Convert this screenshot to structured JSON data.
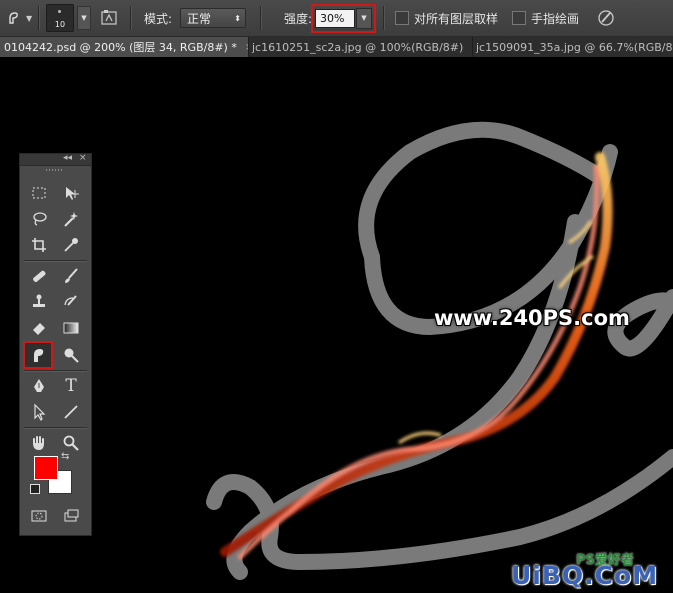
{
  "options_bar": {
    "brush_size": "10",
    "mode_label": "模式:",
    "mode_value": "正常",
    "strength_label": "强度:",
    "strength_value": "30%",
    "sample_all_layers_label": "对所有图层取样",
    "finger_painting_label": "手指绘画",
    "sample_all_layers_checked": false,
    "finger_painting_checked": false
  },
  "tabs": [
    {
      "label": "0104242.psd @ 200% (图层 34, RGB/8#) *",
      "active": true
    },
    {
      "label": "jc1610251_sc2a.jpg @ 100%(RGB/8#)",
      "active": false
    },
    {
      "label": "jc1509091_35a.jpg @ 66.7%(RGB/8#)",
      "active": false
    }
  ],
  "tab_close_glyph": "×",
  "canvas": {
    "watermark": "www.240PS.com",
    "site_mark": "UiBQ.CoM",
    "site_sub": "PS爱好者"
  },
  "toolbox": {
    "collapse_glyph": "◂◂",
    "close_glyph": "×",
    "selected_tool": "smudge-tool",
    "foreground_color": "#ff0000",
    "background_color": "#ffffff",
    "type_tool_glyph": "T"
  },
  "colors": {
    "highlight": "#d01818",
    "stroke_gray": "#7a7a7a"
  }
}
